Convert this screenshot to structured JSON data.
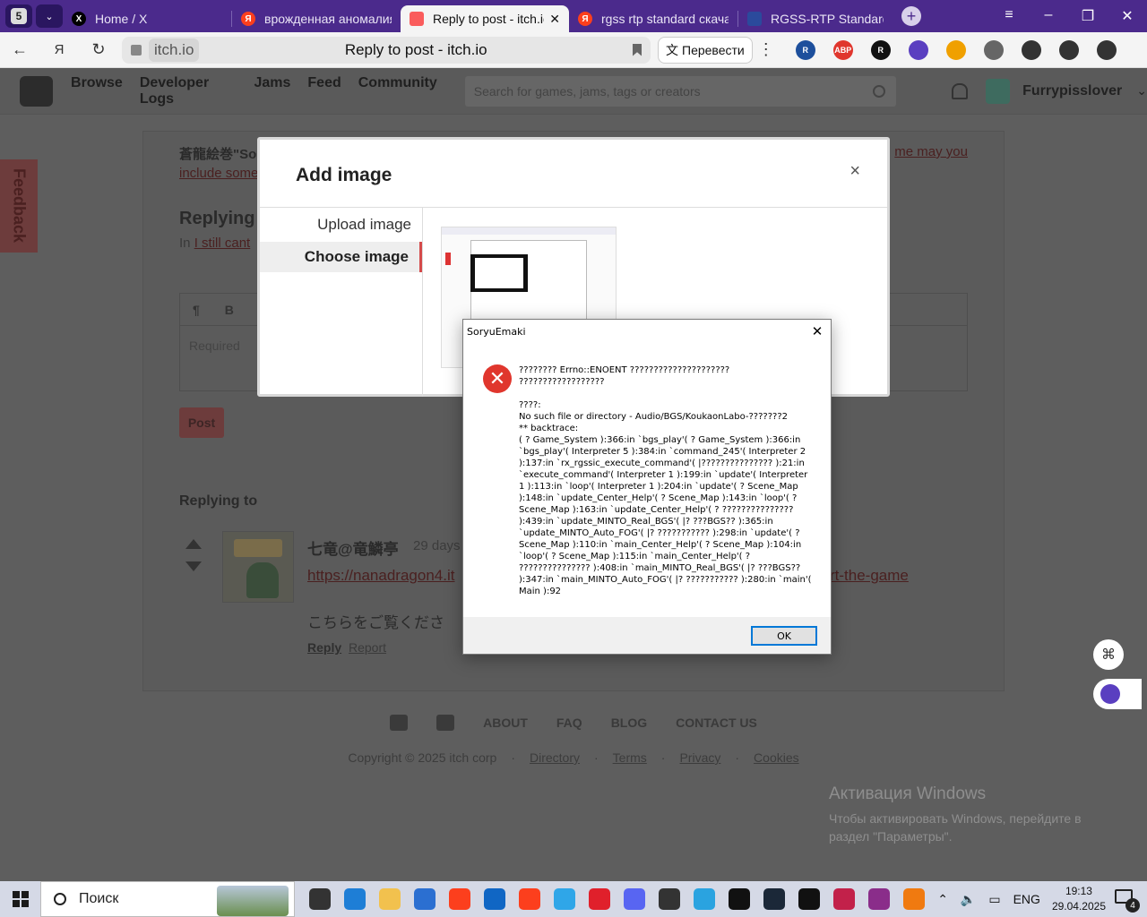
{
  "browser": {
    "tab_counter": "5",
    "tabs": [
      {
        "label": "Home / X",
        "icon": "x-logo-icon",
        "color": "#000000"
      },
      {
        "label": "врожденная аномалия р",
        "icon": "yandex-icon",
        "color": "#fc3f1d"
      },
      {
        "label": "Reply to post - itch.io",
        "icon": "itch-icon",
        "color": "#fa5c5c"
      },
      {
        "label": "rgss rtp standard скачат",
        "icon": "yandex-icon",
        "color": "#fc3f1d"
      },
      {
        "label": "RGSS-RTP Standard - Do",
        "icon": "wallet-icon",
        "color": "#2b4a9c"
      }
    ],
    "address": {
      "domain": "itch.io",
      "page_title": "Reply to post - itch.io"
    },
    "translate_label": "Перевести",
    "extensions": [
      {
        "name": "r-extension-icon",
        "color": "#1d4f9c",
        "text": "R"
      },
      {
        "name": "adblock-plus-icon",
        "color": "#e0362d",
        "text": "ABP"
      },
      {
        "name": "r-dark-icon",
        "color": "#111111",
        "text": "R"
      },
      {
        "name": "face-icon",
        "color": "#5a3fc0",
        "text": ""
      },
      {
        "name": "key-icon",
        "color": "#f0a000",
        "text": ""
      },
      {
        "name": "shield-icon",
        "color": "#666666",
        "text": ""
      },
      {
        "name": "video-icon",
        "color": "#333333",
        "text": ""
      },
      {
        "name": "puzzle-icon",
        "color": "#333333",
        "text": ""
      },
      {
        "name": "download-icon",
        "color": "#333333",
        "text": ""
      }
    ]
  },
  "itch": {
    "nav": [
      "Browse",
      "Developer Logs",
      "Jams",
      "Feed",
      "Community"
    ],
    "search_placeholder": "Search for games, jams, tags or creators",
    "username": "Furrypisslover",
    "feedback_label": "Feedback",
    "question_snippet": "蒼龍絵巻\"So",
    "question_snippet_2": "include some",
    "question_snippet_right": "me may you",
    "replying_heading": "Replying",
    "in_label": "In",
    "in_link": "I still cant",
    "editor_tools": [
      "¶",
      "B"
    ],
    "editor_placeholder": "Required",
    "post_button": "Post",
    "replying_to_heading": "Replying to",
    "post": {
      "author": "七竜@竜鱗亭",
      "time": "29 days",
      "link": "https://nanadragon4.it",
      "link_tail": "rt-the-game",
      "text": "こちらをご覧くださ",
      "reply": "Reply",
      "report": "Report"
    },
    "footer_links": [
      "ABOUT",
      "FAQ",
      "BLOG",
      "CONTACT US"
    ],
    "copyright": "Copyright © 2025 itch corp",
    "footer_small": [
      "Directory",
      "Terms",
      "Privacy",
      "Cookies"
    ]
  },
  "modal": {
    "title": "Add image",
    "close": "×",
    "menu": [
      "Upload image",
      "Choose image"
    ],
    "active_index": 1
  },
  "dialog": {
    "title": "SoryuEmaki",
    "close": "✕",
    "message": "???????? Errno::ENOENT ?????????????????????\n??????????????????\n\n????:\nNo such file or directory - Audio/BGS/KoukaonLabo-???????2\n** backtrace:\n( ? Game_System ):366:in `bgs_play'( ? Game_System ):366:in `bgs_play'( Interpreter 5 ):384:in `command_245'( Interpreter 2 ):137:in `rx_rgssic_execute_command'( |??????????????? ):21:in `execute_command'( Interpreter 1 ):199:in `update'( Interpreter 1 ):113:in `loop'( Interpreter 1 ):204:in `update'( ? Scene_Map ):148:in `update_Center_Help'( ? Scene_Map ):143:in `loop'( ? Scene_Map ):163:in `update_Center_Help'( ? ??????????????? ):439:in `update_MINTO_Real_BGS'( |? ???BGS?? ):365:in `update_MINTO_Auto_FOG'( |? ??????????? ):298:in `update'( ? Scene_Map ):110:in `main_Center_Help'( ? Scene_Map ):104:in `loop'( ? Scene_Map ):115:in `main_Center_Help'( ? ??????????????? ):408:in `main_MINTO_Real_BGS'( |? ???BGS?? ):347:in `main_MINTO_Auto_FOG'( |? ??????????? ):280:in `main'( Main ):92",
    "ok_label": "OK"
  },
  "windows_watermark": {
    "heading": "Активация Windows",
    "text": "Чтобы активировать Windows, перейдите в раздел \"Параметры\"."
  },
  "taskbar": {
    "search_label": "Поиск",
    "apps": [
      {
        "name": "task-view-icon",
        "color": "#333333"
      },
      {
        "name": "edge-icon",
        "color": "#1e7ed6"
      },
      {
        "name": "file-explorer-icon",
        "color": "#f2c14e"
      },
      {
        "name": "store-icon",
        "color": "#2b6fd1"
      },
      {
        "name": "yandex-icon",
        "color": "#fc3f1d"
      },
      {
        "name": "outlook-icon",
        "color": "#1066c4"
      },
      {
        "name": "yandex-browser-icon",
        "color": "#fc3f1d"
      },
      {
        "name": "app-w-icon",
        "color": "#2fa6e8"
      },
      {
        "name": "opera-icon",
        "color": "#e0202b"
      },
      {
        "name": "discord-icon",
        "color": "#5865f2"
      },
      {
        "name": "lock-app-icon",
        "color": "#333333"
      },
      {
        "name": "telegram-icon",
        "color": "#2aa3e0"
      },
      {
        "name": "epic-games-icon",
        "color": "#111111"
      },
      {
        "name": "steam-icon",
        "color": "#1b2838"
      },
      {
        "name": "burst-app-icon",
        "color": "#111111"
      },
      {
        "name": "app-red-icon",
        "color": "#c2214a"
      },
      {
        "name": "winrar-icon",
        "color": "#8a2d8a"
      },
      {
        "name": "sun-app-icon",
        "color": "#f07a10"
      }
    ],
    "language": "ENG",
    "time": "19:13",
    "date": "29.04.2025",
    "notification_count": "4"
  }
}
